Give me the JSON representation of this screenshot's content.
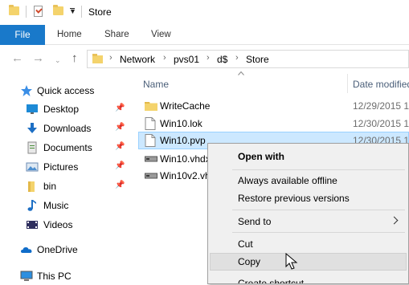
{
  "window": {
    "title": "Store"
  },
  "ribbon": {
    "tabs": [
      "File",
      "Home",
      "Share",
      "View"
    ]
  },
  "address": {
    "crumbs": [
      "Network",
      "pvs01",
      "d$",
      "Store"
    ]
  },
  "columns": {
    "name": "Name",
    "date": "Date modified"
  },
  "sidebar": {
    "items": [
      {
        "label": "Quick access",
        "icon": "star-icon"
      },
      {
        "label": "Desktop",
        "icon": "desktop-icon",
        "pinned": true
      },
      {
        "label": "Downloads",
        "icon": "download-icon",
        "pinned": true
      },
      {
        "label": "Documents",
        "icon": "documents-icon",
        "pinned": true
      },
      {
        "label": "Pictures",
        "icon": "pictures-icon",
        "pinned": true
      },
      {
        "label": "bin",
        "icon": "folder-icon",
        "pinned": true
      },
      {
        "label": "Music",
        "icon": "music-icon"
      },
      {
        "label": "Videos",
        "icon": "videos-icon"
      },
      {
        "label": "OneDrive",
        "icon": "cloud-icon"
      },
      {
        "label": "This PC",
        "icon": "computer-icon"
      }
    ]
  },
  "files": [
    {
      "name": "WriteCache",
      "date": "12/29/2015 1",
      "icon": "folder-icon"
    },
    {
      "name": "Win10.lok",
      "date": "12/30/2015 1",
      "icon": "file-icon"
    },
    {
      "name": "Win10.pvp",
      "date": "12/30/2015 1",
      "icon": "file-icon",
      "selected": true
    },
    {
      "name": "Win10.vhdx",
      "date": "",
      "icon": "disk-icon"
    },
    {
      "name": "Win10v2.vhdx",
      "date": "",
      "icon": "disk-icon"
    }
  ],
  "context_menu": {
    "items": [
      {
        "label": "Open with",
        "bold": true
      },
      {
        "label": "Always available offline"
      },
      {
        "label": "Restore previous versions"
      },
      {
        "label": "Send to",
        "submenu": true
      },
      {
        "label": "Cut"
      },
      {
        "label": "Copy",
        "hover": true
      },
      {
        "label": "Create shortcut"
      }
    ]
  },
  "colors": {
    "accent": "#1979ca",
    "selection": "#cce8ff",
    "header_text": "#4c607a"
  }
}
